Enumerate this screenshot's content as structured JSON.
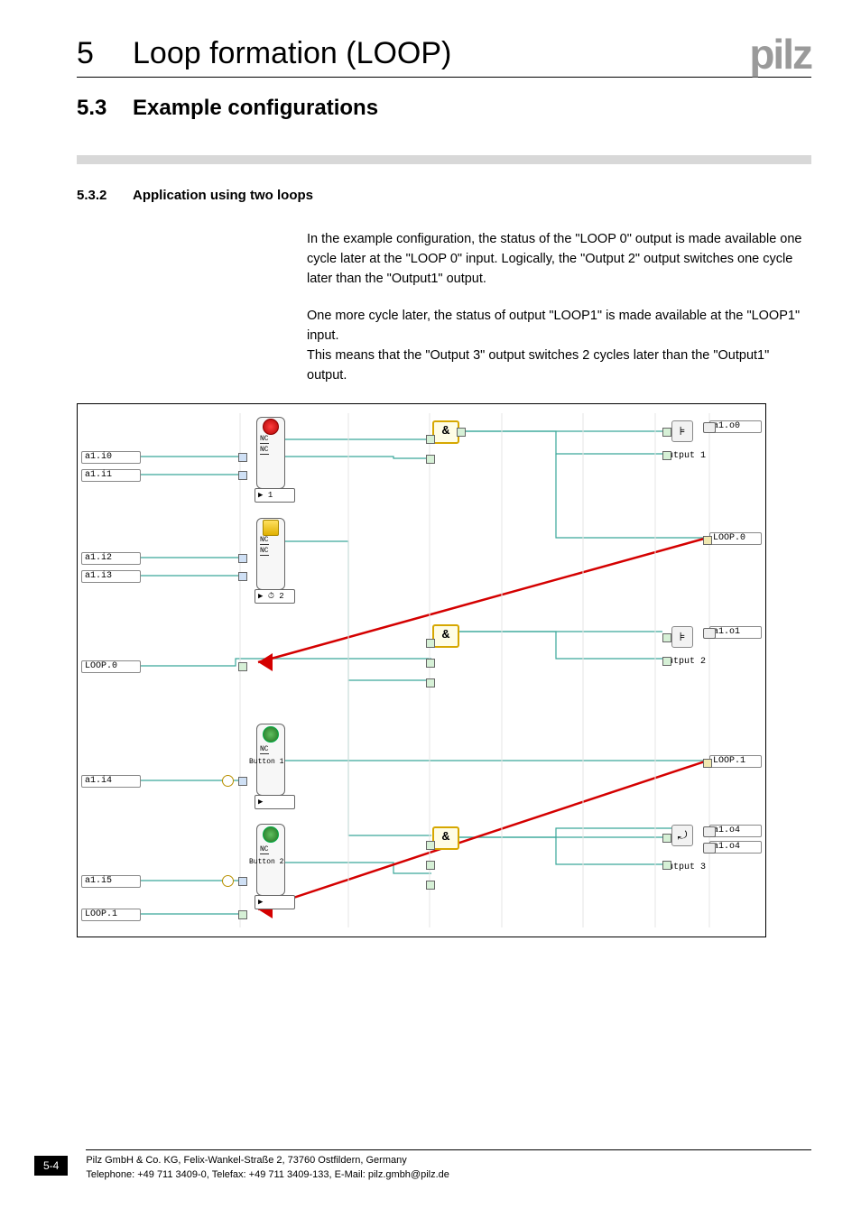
{
  "header": {
    "chapter_num": "5",
    "chapter_title": "Loop formation (LOOP)",
    "logo_text": "pilz"
  },
  "section": {
    "num": "5.3",
    "title": "Example configurations"
  },
  "subsection": {
    "num": "5.3.2",
    "title": "Application using two loops"
  },
  "paragraphs": {
    "p1": "In the example configuration, the status of the \"LOOP 0\" output is made available one cycle later at the \"LOOP 0\" input. Logically, the \"Output 2\" output switches one cycle later than the \"Output1\" output.",
    "p2a": "One more cycle later, the status of output \"LOOP1\" is made available at the \"LOOP1\" input.",
    "p2b": "This means that the \"Output 3\" output switches 2 cycles later than the \"Output1\" output."
  },
  "diagram": {
    "left_io": {
      "a1i0": "a1.i0",
      "a1i1": "a1.i1",
      "a1i2": "a1.i2",
      "a1i3": "a1.i3",
      "loop0": "LOOP.0",
      "a1i4": "a1.i4",
      "a1i5": "a1.i5",
      "loop1": "LOOP.1"
    },
    "right_io": {
      "a1o0": "a1.o0",
      "loop0": "LOOP.0",
      "a1o1": "a1.o1",
      "loop1": "LOOP.1",
      "a1o4a": "a1.o4",
      "a1o4b": "a1.o4"
    },
    "out_labels": {
      "out1": "Output 1",
      "out2": "Output 2",
      "out3": "Output 3"
    },
    "and_symbol": "&",
    "key_symbol": "⊧",
    "twohand_symbol": "⤾",
    "nc": "NC",
    "button1": "Button 1",
    "button2": "Button 2",
    "timer1": "▶       1",
    "timer2": "▶ ⏱  2",
    "timer3": "▶",
    "timer4": "▶"
  },
  "footer": {
    "page": "5-4",
    "line1": "Pilz GmbH & Co. KG, Felix-Wankel-Straße 2, 73760 Ostfildern, Germany",
    "line2": "Telephone: +49 711 3409-0, Telefax: +49 711 3409-133, E-Mail: pilz.gmbh@pilz.de"
  }
}
